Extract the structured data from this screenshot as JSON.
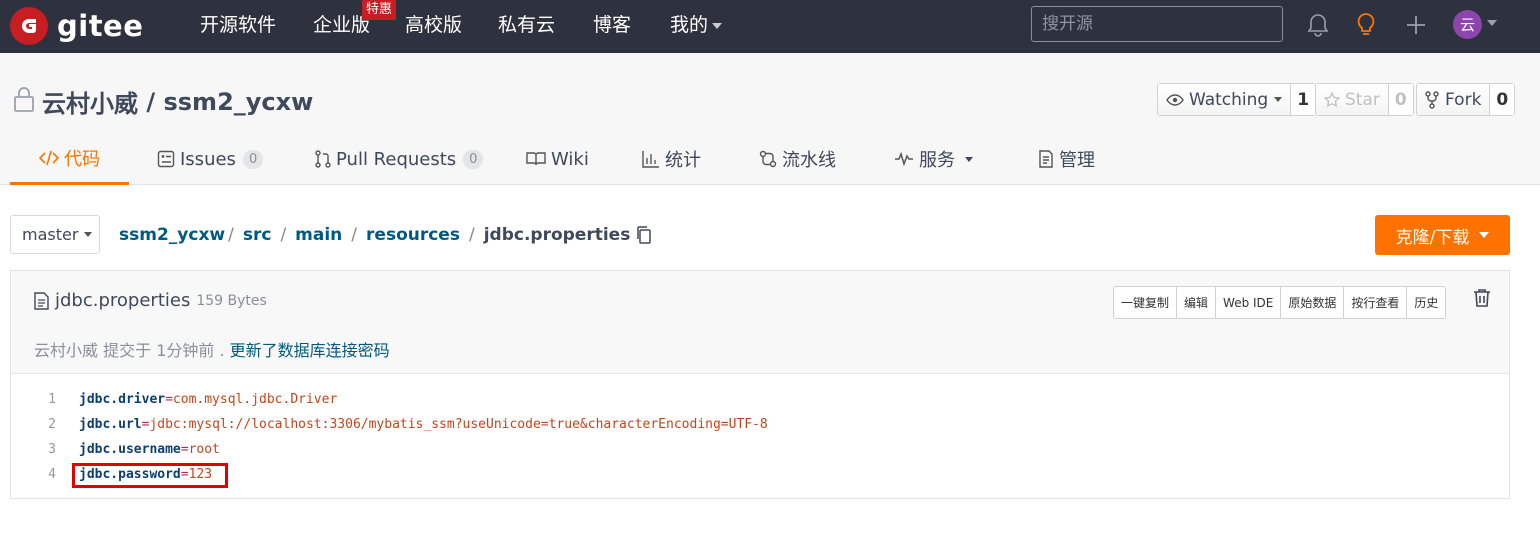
{
  "topbar": {
    "brand": "gitee",
    "nav": [
      "开源软件",
      "企业版",
      "高校版",
      "私有云",
      "博客",
      "我的"
    ],
    "badge": "特惠",
    "search_placeholder": "搜开源",
    "avatar_text": "云",
    "icons": [
      "bell-icon",
      "lightbulb-icon",
      "plus-icon"
    ]
  },
  "repo": {
    "owner": "云村小威",
    "separator": " / ",
    "name": "ssm2_ycxw",
    "watch_label": "Watching",
    "watch_count": "1",
    "star_label": "Star",
    "star_count": "0",
    "fork_label": "Fork",
    "fork_count": "0"
  },
  "tabs": [
    {
      "label": "代码",
      "count": null
    },
    {
      "label": "Issues",
      "count": "0"
    },
    {
      "label": "Pull Requests",
      "count": "0"
    },
    {
      "label": "Wiki",
      "count": null
    },
    {
      "label": "统计",
      "count": null
    },
    {
      "label": "流水线",
      "count": null
    },
    {
      "label": "服务",
      "count": null
    },
    {
      "label": "管理",
      "count": null
    }
  ],
  "branch": "master",
  "breadcrumb": [
    "ssm2_ycxw",
    "src",
    "main",
    "resources",
    "jdbc.properties"
  ],
  "clone_label": "克隆/下载",
  "file": {
    "name": "jdbc.properties",
    "size": "159 Bytes",
    "actions": [
      "一键复制",
      "编辑",
      "Web IDE",
      "原始数据",
      "按行查看",
      "历史"
    ],
    "commit_author": "云村小威",
    "commit_meta": "提交于 1分钟前 .",
    "commit_message": "更新了数据库连接密码",
    "lines": [
      {
        "num": "1",
        "key": "jdbc.driver",
        "op": "=",
        "value": "com.mysql.jdbc.Driver"
      },
      {
        "num": "2",
        "key": "jdbc.url",
        "op": "=",
        "value": "jdbc:mysql://localhost:3306/mybatis_ssm?useUnicode=true&characterEncoding=UTF-8"
      },
      {
        "num": "3",
        "key": "jdbc.username",
        "op": "=",
        "value": "root"
      },
      {
        "num": "4",
        "key": "jdbc.password",
        "op": "=",
        "value": "123"
      }
    ]
  },
  "colors": {
    "brand_red": "#c71d23",
    "accent_orange": "#fe7300",
    "topbar_bg": "#2e323e",
    "highlight_border": "#e00000"
  }
}
